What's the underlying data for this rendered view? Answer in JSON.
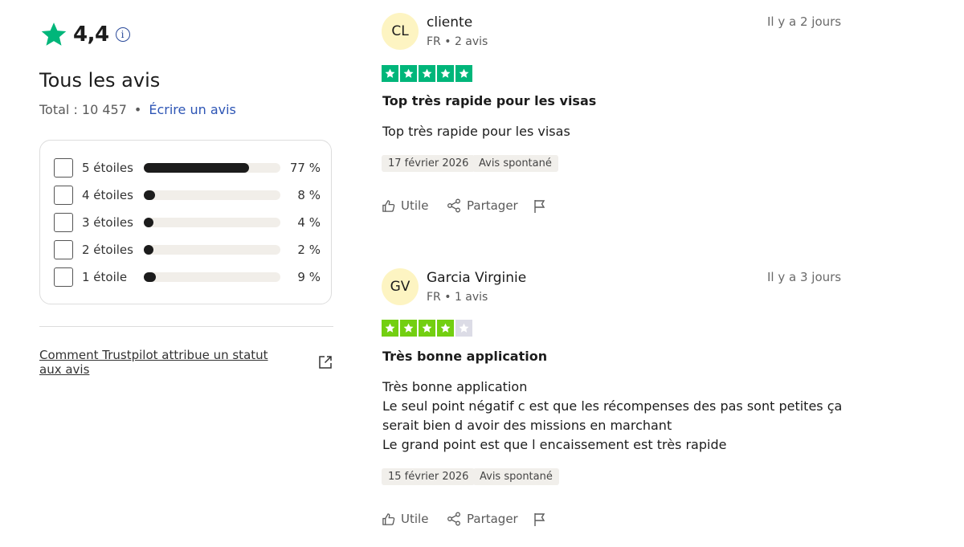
{
  "summary": {
    "score": "4,4",
    "info_icon": "ⓘ",
    "title": "Tous les avis",
    "total_label": "Total : 10 457",
    "separator": "•",
    "write_review": "Écrire un avis",
    "star_color": "#00b67a"
  },
  "distribution": [
    {
      "label": "5 étoiles",
      "percent_label": "77 %",
      "fraction": 0.77
    },
    {
      "label": "4 étoiles",
      "percent_label": "8 %",
      "fraction": 0.08
    },
    {
      "label": "3 étoiles",
      "percent_label": "4 %",
      "fraction": 0.04
    },
    {
      "label": "2 étoiles",
      "percent_label": "2 %",
      "fraction": 0.02
    },
    {
      "label": "1 étoile",
      "percent_label": "9 %",
      "fraction": 0.09
    }
  ],
  "trust_link": "Comment Trustpilot attribue un statut aux avis",
  "reviews": [
    {
      "initials": "CL",
      "name": "cliente",
      "meta": "FR • 2 avis",
      "relative_date": "Il y a 2 jours",
      "stars": 5,
      "star_color": "#00b67a",
      "title": "Top très rapide pour les visas",
      "body": [
        "Top très rapide pour les visas"
      ],
      "date_tag": "17 février 2026",
      "type_tag": "Avis spontané",
      "helpful": "Utile",
      "share": "Partager"
    },
    {
      "initials": "GV",
      "name": "Garcia Virginie",
      "meta": "FR • 1 avis",
      "relative_date": "Il y a 3 jours",
      "stars": 4,
      "star_color": "#73cf11",
      "title": "Très bonne application",
      "body": [
        "Très bonne application",
        "Le seul point négatif c est que les récompenses des pas sont petites ça",
        "serait bien d avoir des missions en marchant",
        "Le grand point est que l encaissement est très rapide"
      ],
      "date_tag": "15 février 2026",
      "type_tag": "Avis spontané",
      "helpful": "Utile",
      "share": "Partager"
    }
  ]
}
